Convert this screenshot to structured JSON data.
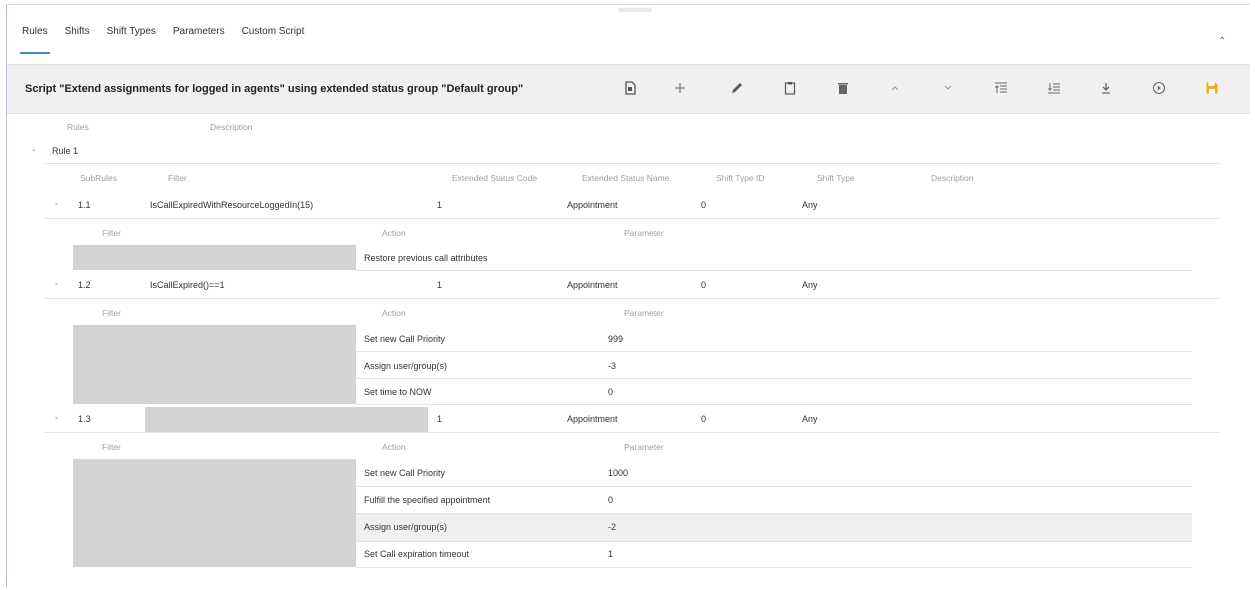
{
  "tabs": [
    {
      "label": "Rules"
    },
    {
      "label": "Shifts"
    },
    {
      "label": "Shift Types"
    },
    {
      "label": "Parameters"
    },
    {
      "label": "Custom Script"
    }
  ],
  "active_tab": "Rules",
  "toolbar": {
    "title": "Script \"Extend assignments for logged in agents\" using extended status group \"Default group\"",
    "icons": [
      "document-icon",
      "plus-icon",
      "pencil-icon",
      "clipboard-icon",
      "trash-icon",
      "chevron-up-icon",
      "chevron-down-icon",
      "move-top-icon",
      "move-bottom-icon",
      "download-icon",
      "play-circle-icon",
      "save-icon"
    ],
    "accent_color": "#f5a623"
  },
  "rules_header": {
    "rules": "Rules",
    "description": "Description"
  },
  "rule": {
    "name": "Rule 1",
    "toggle": "-"
  },
  "subrule_header": {
    "subrules": "SubRules",
    "filter": "Filter",
    "status_code": "Extended Status Code",
    "status_name": "Extended Status Name",
    "shift_type_id": "Shift Type ID",
    "shift_type": "Shift Type",
    "description": "Description"
  },
  "action_header": {
    "filter": "Filter",
    "action": "Action",
    "parameter": "Parameter"
  },
  "subrules": [
    {
      "id": "1.1",
      "filter": "IsCallExpiredWithResourceLoggedIn(15)",
      "status_code": "1",
      "status_name": "Appointment",
      "shift_type_id": "0",
      "shift_type": "Any",
      "actions": [
        {
          "action": "Restore previous call attributes",
          "parameter": ""
        }
      ]
    },
    {
      "id": "1.2",
      "filter": "IsCallExpired()==1",
      "status_code": "1",
      "status_name": "Appointment",
      "shift_type_id": "0",
      "shift_type": "Any",
      "actions": [
        {
          "action": "Set new Call Priority",
          "parameter": "999"
        },
        {
          "action": "Assign user/group(s)",
          "parameter": "-3"
        },
        {
          "action": "Set time to NOW",
          "parameter": "0"
        }
      ]
    },
    {
      "id": "1.3",
      "filter": "",
      "status_code": "1",
      "status_name": "Appointment",
      "shift_type_id": "0",
      "shift_type": "Any",
      "actions": [
        {
          "action": "Set new Call Priority",
          "parameter": "1000"
        },
        {
          "action": "Fulfill the specified appointment",
          "parameter": "0"
        },
        {
          "action": "Assign user/group(s)",
          "parameter": "-2"
        },
        {
          "action": "Set Call expiration timeout",
          "parameter": "1"
        }
      ]
    }
  ],
  "highlighted_action": {
    "subrule": 2,
    "action": 2
  }
}
